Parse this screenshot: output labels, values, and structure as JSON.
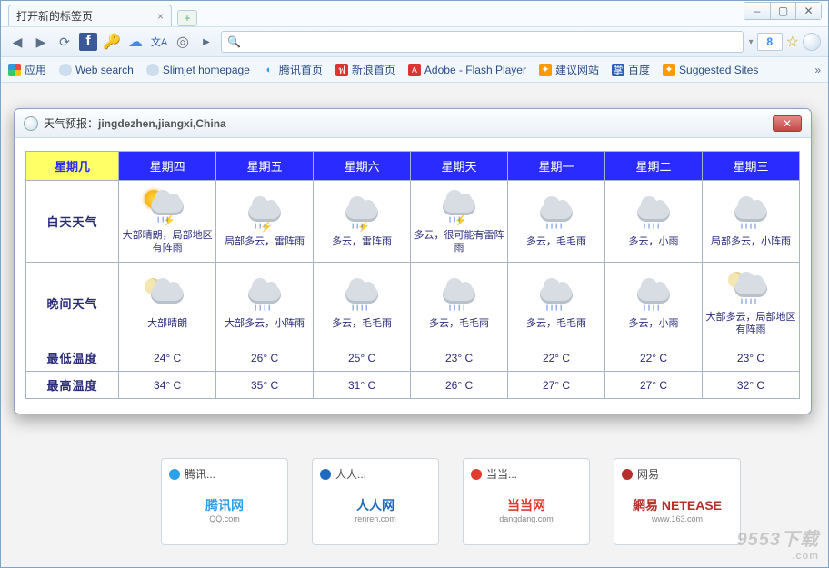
{
  "window": {
    "min": "–",
    "max": "▢",
    "close": "✕"
  },
  "tab": {
    "title": "打开新的标签页",
    "close": "×",
    "new": "+"
  },
  "toolbar": {
    "back": "◀",
    "fwd": "▶",
    "reload": "⟳",
    "search_placeholder": ""
  },
  "bookmarks": {
    "apps": "应用",
    "items": [
      "Web search",
      "Slimjet homepage",
      "腾讯首页",
      "新浪首页",
      "Adobe - Flash Player",
      "建议网站",
      "百度",
      "Suggested Sites"
    ],
    "overflow": "»"
  },
  "weather": {
    "title_prefix": "天气预报：",
    "location": "jingdezhen,jiangxi,China",
    "close": "✕",
    "headers": {
      "dow": "星期几",
      "days": [
        "星期四",
        "星期五",
        "星期六",
        "星期天",
        "星期一",
        "星期二",
        "星期三"
      ]
    },
    "rows": {
      "day": "白天天气",
      "night": "晚间天气",
      "low": "最低温度",
      "high": "最高温度"
    },
    "day_icons": [
      "sun-storm",
      "storm",
      "storm",
      "storm",
      "rain",
      "rain",
      "rain"
    ],
    "day_text": [
      "大部晴朗，局部地区有阵雨",
      "局部多云，雷阵雨",
      "多云，雷阵雨",
      "多云，很可能有雷阵雨",
      "多云，毛毛雨",
      "多云，小雨",
      "局部多云，小阵雨"
    ],
    "night_icons": [
      "moon",
      "rain",
      "rain",
      "rain",
      "rain",
      "rain",
      "moon-rain"
    ],
    "night_text": [
      "大部晴朗",
      "大部多云，小阵雨",
      "多云，毛毛雨",
      "多云，毛毛雨",
      "多云，毛毛雨",
      "多云，小雨",
      "大部多云，局部地区有阵雨"
    ],
    "low": [
      "24° C",
      "26° C",
      "25° C",
      "23° C",
      "22° C",
      "22° C",
      "23° C"
    ],
    "high": [
      "34° C",
      "35° C",
      "31° C",
      "26° C",
      "27° C",
      "27° C",
      "32° C"
    ]
  },
  "sites": [
    {
      "label": "腾讯...",
      "brand": "腾讯网",
      "sub": "QQ.com",
      "color": "#2aa1e8"
    },
    {
      "label": "人人...",
      "brand": "人人网",
      "sub": "renren.com",
      "color": "#1d6bbf"
    },
    {
      "label": "当当...",
      "brand": "当当网",
      "sub": "dangdang.com",
      "color": "#e03b2f"
    },
    {
      "label": "网易",
      "brand": "網易 NETEASE",
      "sub": "www.163.com",
      "color": "#b5302b"
    }
  ],
  "watermark": {
    "big": "9553下载",
    "small": ".com"
  }
}
